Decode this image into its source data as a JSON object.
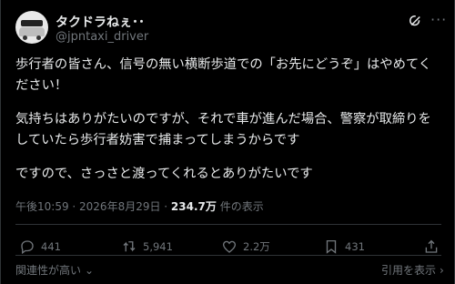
{
  "author": {
    "display_name": "タクドラねぇ･･",
    "handle": "@jpntaxi_driver"
  },
  "post": {
    "lines": [
      "歩行者の皆さん、信号の無い横断歩道での「お先にどうぞ」はやめてください！",
      "気持ちはありがたいのですが、それで車が進んだ場合、警察が取締りをしていたら歩行者妨害で捕まってしまうからです",
      "ですので、さっさと渡ってくれるとありがたいです"
    ]
  },
  "meta": {
    "timestamp": "午後10:59 · 2026年8月29日 · ",
    "views_count": "234.7万",
    "views_label": " 件の表示"
  },
  "actions": {
    "replies": "441",
    "reposts": "5,941",
    "likes": "2.2万",
    "bookmarks": "431"
  },
  "footer": {
    "sort_label": "関連性が高い",
    "quotes_label": "引用を表示"
  },
  "icons": {
    "grok": "grok-icon",
    "more": "more-icon",
    "reply": "reply-icon",
    "repost": "repost-icon",
    "like": "like-icon",
    "bookmark": "bookmark-icon",
    "share": "share-icon"
  },
  "colors": {
    "background": "#000000",
    "text": "#e7e9ea",
    "muted": "#71767b",
    "divider": "#2f3336"
  }
}
